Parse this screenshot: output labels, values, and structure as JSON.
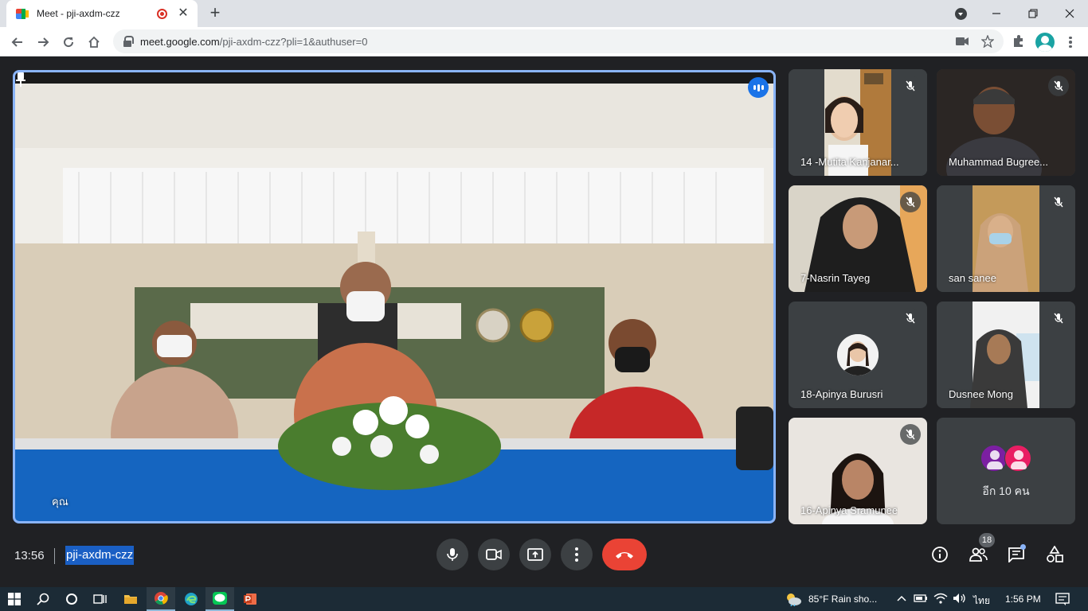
{
  "browser": {
    "tab_title": "Meet - pji-axdm-czz",
    "url_host": "meet.google.com",
    "url_path": "/pji-axdm-czz?pli=1&authuser=0"
  },
  "meeting": {
    "main_speaker_name": "คุณ",
    "time": "13:56",
    "code": "pji-axdm-czz",
    "participant_count": "18"
  },
  "participants": [
    {
      "name": "14 -Mutita Kanjanar...",
      "muted": true
    },
    {
      "name": "Muhammad Bugree...",
      "muted": true
    },
    {
      "name": "7-Nasrin Tayeg",
      "muted": true
    },
    {
      "name": "san sanee",
      "muted": true
    },
    {
      "name": "18-Apinya Burusri",
      "muted": true
    },
    {
      "name": "Dusnee Mong",
      "muted": true
    },
    {
      "name": "16-Apinya Sramunee",
      "muted": true
    }
  ],
  "more_tile": {
    "label": "อีก 10 คน"
  },
  "taskbar": {
    "weather": "85°F  Rain sho...",
    "language": "ไทย",
    "time": "1:56 PM"
  },
  "colors": {
    "meet_background": "#202124",
    "tile_background": "#3c4043",
    "active_speaker_border": "#8ab4f8",
    "end_call": "#ea4335",
    "code_highlight": "#1a5fc4"
  }
}
